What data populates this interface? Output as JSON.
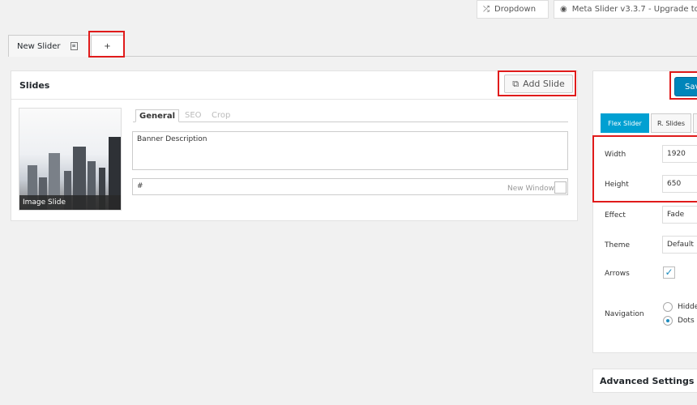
{
  "toolbar": {
    "dropdown_label": "Dropdown",
    "dropdown_icon": "shuffle-icon",
    "meta_label": "Meta Slider v3.3.7 - Upgrade to",
    "meta_icon": "dashboard-icon"
  },
  "tabs": {
    "slider_name": "New Slider",
    "add_label": "+"
  },
  "slides": {
    "title": "Slides",
    "add_slide_label": "Add Slide",
    "thumb_label": "Image Slide",
    "edit_tabs": [
      "General",
      "SEO",
      "Crop"
    ],
    "description": "Banner Description",
    "url": "#",
    "new_window_label": "New Window"
  },
  "settings": {
    "save_label": "Sav",
    "slider_types": [
      "Flex Slider",
      "R. Slides"
    ],
    "width_label": "Width",
    "width_value": "1920",
    "height_label": "Height",
    "height_value": "650",
    "effect_label": "Effect",
    "effect_value": "Fade",
    "theme_label": "Theme",
    "theme_value": "Default",
    "arrows_label": "Arrows",
    "arrows_checked": true,
    "navigation_label": "Navigation",
    "navigation_options": [
      "Hidde",
      "Dots"
    ],
    "navigation_selected": "Dots",
    "advanced_label": "Advanced Settings"
  },
  "colors": {
    "highlight": "#e01b1b",
    "primary_blue": "#0085ba",
    "tab_blue": "#00a0d2"
  }
}
